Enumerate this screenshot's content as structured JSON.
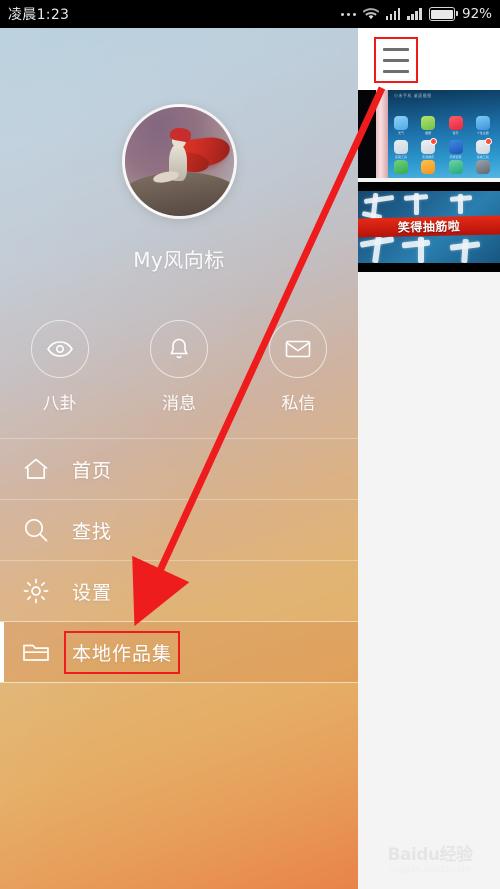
{
  "status_bar": {
    "clock": "凌晨1:23",
    "battery_percent": "92%",
    "icons": [
      "more-dots-icon",
      "wifi-icon",
      "signal-bars-icon",
      "signal-bars-icon",
      "battery-icon"
    ]
  },
  "drawer": {
    "username": "My风向标",
    "avatar_alt": "user-avatar",
    "circle_actions": [
      {
        "label": "八卦",
        "icon": "eye-icon"
      },
      {
        "label": "消息",
        "icon": "bell-icon"
      },
      {
        "label": "私信",
        "icon": "envelope-icon"
      }
    ],
    "menu_items": [
      {
        "label": "首页",
        "icon": "home-icon",
        "selected": false
      },
      {
        "label": "查找",
        "icon": "search-icon",
        "selected": false
      },
      {
        "label": "设置",
        "icon": "gear-icon",
        "selected": false
      },
      {
        "label": "本地作品集",
        "icon": "folder-icon",
        "selected": true
      }
    ]
  },
  "content": {
    "menu_button_icon": "hamburger-menu-icon",
    "thumbnails": [
      {
        "name": "phone-home-screen-photo",
        "screen_label": "小米手机 桌面截图",
        "app_rows": [
          [
            {
              "caption": "天气",
              "color1": "#8fd2f4",
              "color2": "#4fa9e8",
              "badge": false
            },
            {
              "caption": "相册",
              "color1": "#b7e36a",
              "color2": "#6cc24a",
              "badge": false
            },
            {
              "caption": "音乐",
              "color1": "#fb5d6a",
              "color2": "#e8283f",
              "badge": false
            },
            {
              "caption": "个性主题",
              "color1": "#7ad0f0",
              "color2": "#3f8fe0",
              "badge": false
            }
          ],
          [
            {
              "caption": "实用工具",
              "color1": "#e8eef3",
              "color2": "#c9d6e0",
              "badge": false
            },
            {
              "caption": "影音娱乐",
              "color1": "#eef1f4",
              "color2": "#ccd6de",
              "badge": true
            },
            {
              "caption": "手机管家",
              "color1": "#2f7ee0",
              "color2": "#1c57b5",
              "badge": false
            },
            {
              "caption": "系统工具",
              "color1": "#eef1f4",
              "color2": "#ccd6de",
              "badge": true
            }
          ]
        ],
        "dock": [
          {
            "caption": "电话",
            "color1": "#6fd27d",
            "color2": "#37a84f"
          },
          {
            "caption": "短信",
            "color1": "#ffc14d",
            "color2": "#f59420"
          },
          {
            "caption": "安全中心",
            "color1": "#6ed3a6",
            "color2": "#23a97a"
          },
          {
            "caption": "设置",
            "color1": "#9aa4ad",
            "color2": "#5e6973"
          }
        ],
        "page_dots": "• •"
      },
      {
        "name": "video-thumbnail-funny",
        "banner_text": "笑得抽筋啦"
      }
    ],
    "watermark": {
      "main": "Baidu经验",
      "sub": "jingyan.baidu.com"
    }
  },
  "annotations": {
    "highlight_color": "#ef1a1a",
    "arrow_color": "#ee1c1c",
    "arrow_from": "hamburger-menu-icon",
    "arrow_to": "local-works-menu-item"
  }
}
